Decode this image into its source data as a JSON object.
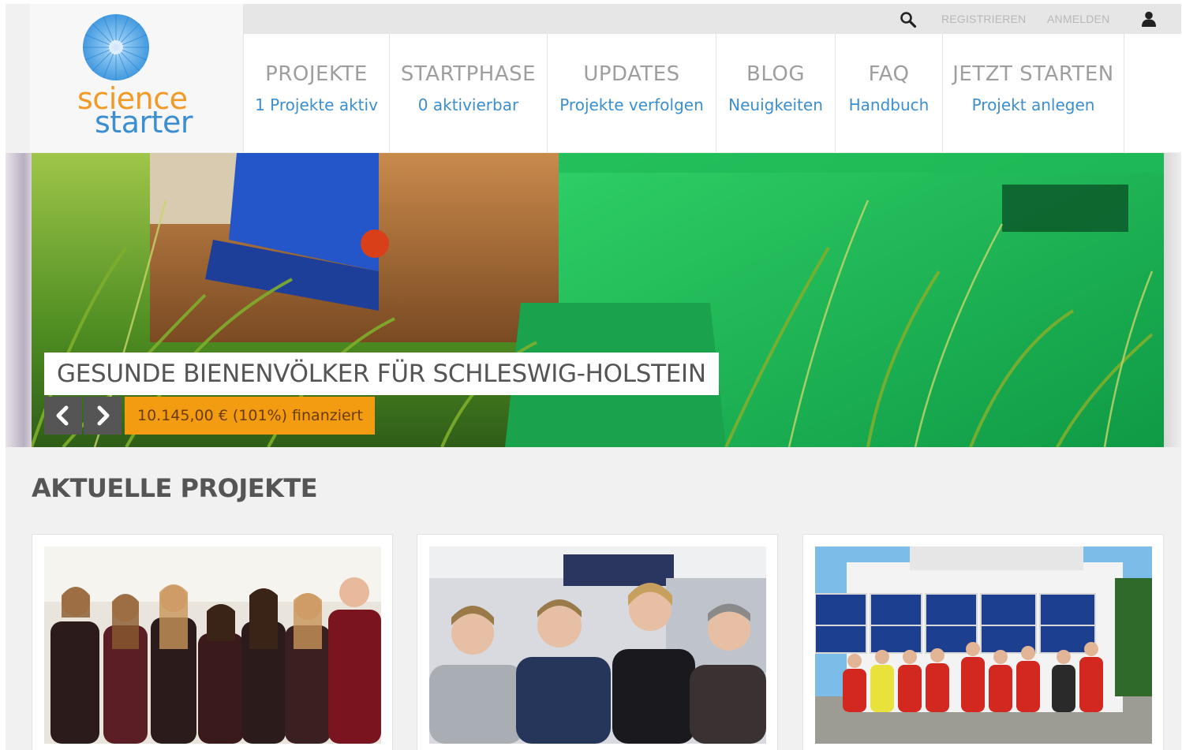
{
  "topbar": {
    "register_label": "REGISTRIEREN",
    "login_label": "ANMELDEN",
    "icons": {
      "search": "search-icon",
      "user": "user-icon"
    }
  },
  "logo": {
    "word1": "science",
    "word2": "starter"
  },
  "nav": [
    {
      "title": "PROJEKTE",
      "sub": "1 Projekte aktiv"
    },
    {
      "title": "STARTPHASE",
      "sub": "0 aktivierbar"
    },
    {
      "title": "UPDATES",
      "sub": "Projekte verfolgen"
    },
    {
      "title": "BLOG",
      "sub": "Neuigkeiten"
    },
    {
      "title": "FAQ",
      "sub": "Handbuch"
    },
    {
      "title": "JETZT STARTEN",
      "sub": "Projekt anlegen"
    }
  ],
  "hero": {
    "title": "GESUNDE BIENENVÖLKER FÜR SCHLESWIG-HOLSTEIN",
    "funded": "10.145,00 € (101%) finanziert",
    "icons": {
      "prev": "chevron-left-icon",
      "next": "chevron-right-icon"
    }
  },
  "section": {
    "title": "AKTUELLE PROJEKTE"
  },
  "colors": {
    "accent_blue": "#3b8fd0",
    "logo_orange": "#f19a26",
    "funded_orange": "#f39c12",
    "nav_title_gray": "#9e9e9e"
  }
}
